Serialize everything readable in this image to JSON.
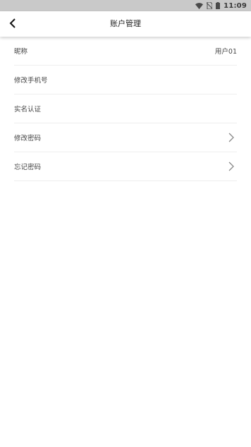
{
  "status_bar": {
    "time": "11:09",
    "icons": [
      "wifi-icon",
      "no-sim-icon",
      "battery-icon"
    ]
  },
  "nav": {
    "title": "账户管理",
    "back_icon": "chevron-left-icon"
  },
  "list": {
    "items": [
      {
        "label": "昵称",
        "value": "用户01"
      },
      {
        "label": "修改手机号"
      },
      {
        "label": "实名认证"
      },
      {
        "label": "修改密码",
        "icon": "chevron-right-icon"
      },
      {
        "label": "忘记密码",
        "icon": "chevron-right-icon"
      }
    ]
  },
  "colors": {
    "status_bar_bg": "#c9c9c9",
    "divider": "#eeeeee",
    "text": "#444444",
    "chevron": "#888888"
  }
}
